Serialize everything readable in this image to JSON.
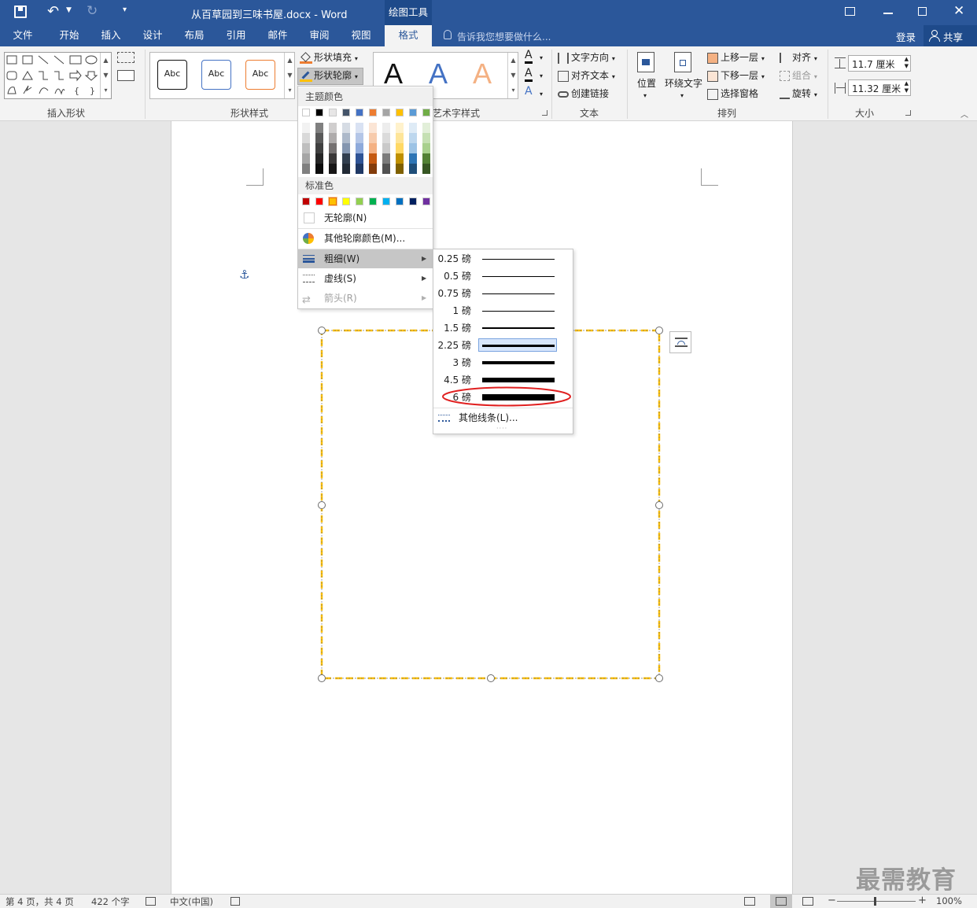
{
  "title_bar": {
    "doc_title": "从百草园到三味书屋.docx - Word",
    "context_tool": "绘图工具"
  },
  "tabs": [
    "文件",
    "开始",
    "插入",
    "设计",
    "布局",
    "引用",
    "邮件",
    "审阅",
    "视图",
    "格式"
  ],
  "active_tab": "格式",
  "tell_me": "告诉我您想要做什么...",
  "account": {
    "login": "登录",
    "share": "共享"
  },
  "ribbon": {
    "groups": {
      "insert_shapes": "插入形状",
      "shape_styles": "形状样式",
      "art_styles": "艺术字样式",
      "text": "文本",
      "arrange": "排列",
      "size": "大小"
    },
    "shape_style_samples": [
      "Abc",
      "Abc",
      "Abc"
    ],
    "shape_fill": "形状填充",
    "shape_outline": "形状轮廓",
    "text_group": {
      "direction": "文字方向",
      "align": "对齐文本",
      "link": "创建链接"
    },
    "arrange_group": {
      "position": "位置",
      "wrap": "环绕文字",
      "bring_forward": "上移一层",
      "send_backward": "下移一层",
      "selection_pane": "选择窗格",
      "align": "对齐",
      "group": "组合",
      "rotate": "旋转"
    },
    "size_group": {
      "height": "11.7 厘米",
      "width": "11.32 厘米"
    }
  },
  "outline_menu": {
    "theme_colors_label": "主题颜色",
    "standard_colors_label": "标准色",
    "no_outline": "无轮廓(N)",
    "more_colors": "其他轮廓颜色(M)...",
    "weight": "粗细(W)",
    "dashes": "虚线(S)",
    "arrows": "箭头(R)",
    "theme_top": [
      "#ffffff",
      "#000000",
      "#e7e6e6",
      "#44546a",
      "#4472c4",
      "#ed7d31",
      "#a5a5a5",
      "#ffc000",
      "#5b9bd5",
      "#70ad47"
    ],
    "theme_shades": [
      [
        "#f2f2f2",
        "#d9d9d9",
        "#bfbfbf",
        "#a6a6a6",
        "#808080"
      ],
      [
        "#808080",
        "#595959",
        "#404040",
        "#262626",
        "#0d0d0d"
      ],
      [
        "#d0cece",
        "#aeabab",
        "#757171",
        "#3a3838",
        "#171616"
      ],
      [
        "#d6dce4",
        "#adb9ca",
        "#8496b0",
        "#323f4f",
        "#222a35"
      ],
      [
        "#d9e2f3",
        "#b4c6e7",
        "#8eaadb",
        "#2f5496",
        "#1f3864"
      ],
      [
        "#fbe5d5",
        "#f7cbac",
        "#f4b183",
        "#c55a11",
        "#833c0b"
      ],
      [
        "#ededed",
        "#dbdbdb",
        "#c9c9c9",
        "#7b7b7b",
        "#525252"
      ],
      [
        "#fff2cc",
        "#fee599",
        "#ffd965",
        "#bf9000",
        "#7f6000"
      ],
      [
        "#deebf6",
        "#bdd7ee",
        "#9cc3e5",
        "#2e75b5",
        "#1f4e79"
      ],
      [
        "#e2efd9",
        "#c5e0b3",
        "#a8d08d",
        "#538135",
        "#375623"
      ]
    ],
    "standard": [
      "#c00000",
      "#ff0000",
      "#ffc000",
      "#ffff00",
      "#92d050",
      "#00b050",
      "#00b0f0",
      "#0070c0",
      "#002060",
      "#7030a0"
    ]
  },
  "weight_submenu": {
    "options": [
      {
        "label": "0.25 磅",
        "pt": 0.25
      },
      {
        "label": "0.5 磅",
        "pt": 0.5
      },
      {
        "label": "0.75 磅",
        "pt": 0.75
      },
      {
        "label": "1 磅",
        "pt": 1
      },
      {
        "label": "1.5 磅",
        "pt": 1.5
      },
      {
        "label": "2.25 磅",
        "pt": 2.25
      },
      {
        "label": "3 磅",
        "pt": 3
      },
      {
        "label": "4.5 磅",
        "pt": 4.5
      },
      {
        "label": "6 磅",
        "pt": 6
      }
    ],
    "highlighted": "2.25 磅",
    "circled": "6 磅",
    "more_lines": "其他线条(L)..."
  },
  "status_bar": {
    "page": "第 4 页，共 4 页",
    "words": "422 个字",
    "language": "中文(中国)",
    "zoom": "100%"
  },
  "watermark": "最需教育",
  "accent_color": "#2b579a",
  "shape_outline_color": "#ffc000"
}
